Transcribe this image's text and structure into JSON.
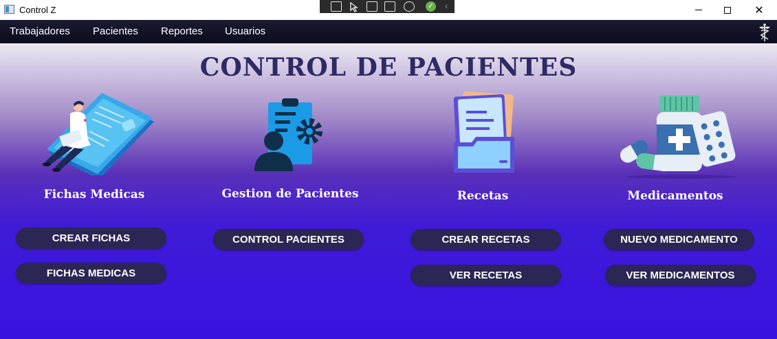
{
  "window": {
    "title": "Control Z"
  },
  "menu": {
    "items": [
      {
        "label": "Trabajadores"
      },
      {
        "label": "Pacientes"
      },
      {
        "label": "Reportes"
      },
      {
        "label": "Usuarios"
      }
    ]
  },
  "main": {
    "title": "CONTROL DE PACIENTES"
  },
  "sections": [
    {
      "title": "Fichas Medicas",
      "icon": "doctor-laptop-card-illustration",
      "buttons": [
        "CREAR FICHAS",
        "FICHAS MEDICAS"
      ]
    },
    {
      "title": "Gestion de Pacientes",
      "icon": "patient-clipboard-gear-icon",
      "buttons": [
        "CONTROL PACIENTES"
      ]
    },
    {
      "title": "Recetas",
      "icon": "folder-documents-icon",
      "buttons": [
        "CREAR RECETAS",
        "VER RECETAS"
      ]
    },
    {
      "title": "Medicamentos",
      "icon": "medicine-bottle-pills-icon",
      "buttons": [
        "NUEVO MEDICAMENTO",
        "VER MEDICAMENTOS"
      ]
    }
  ],
  "colors": {
    "menubar": "#12122a",
    "button_bg": "#2b2653",
    "title_color": "#2e2a64",
    "gradient_top": "#ece8f2",
    "gradient_bottom": "#3a12e0"
  }
}
